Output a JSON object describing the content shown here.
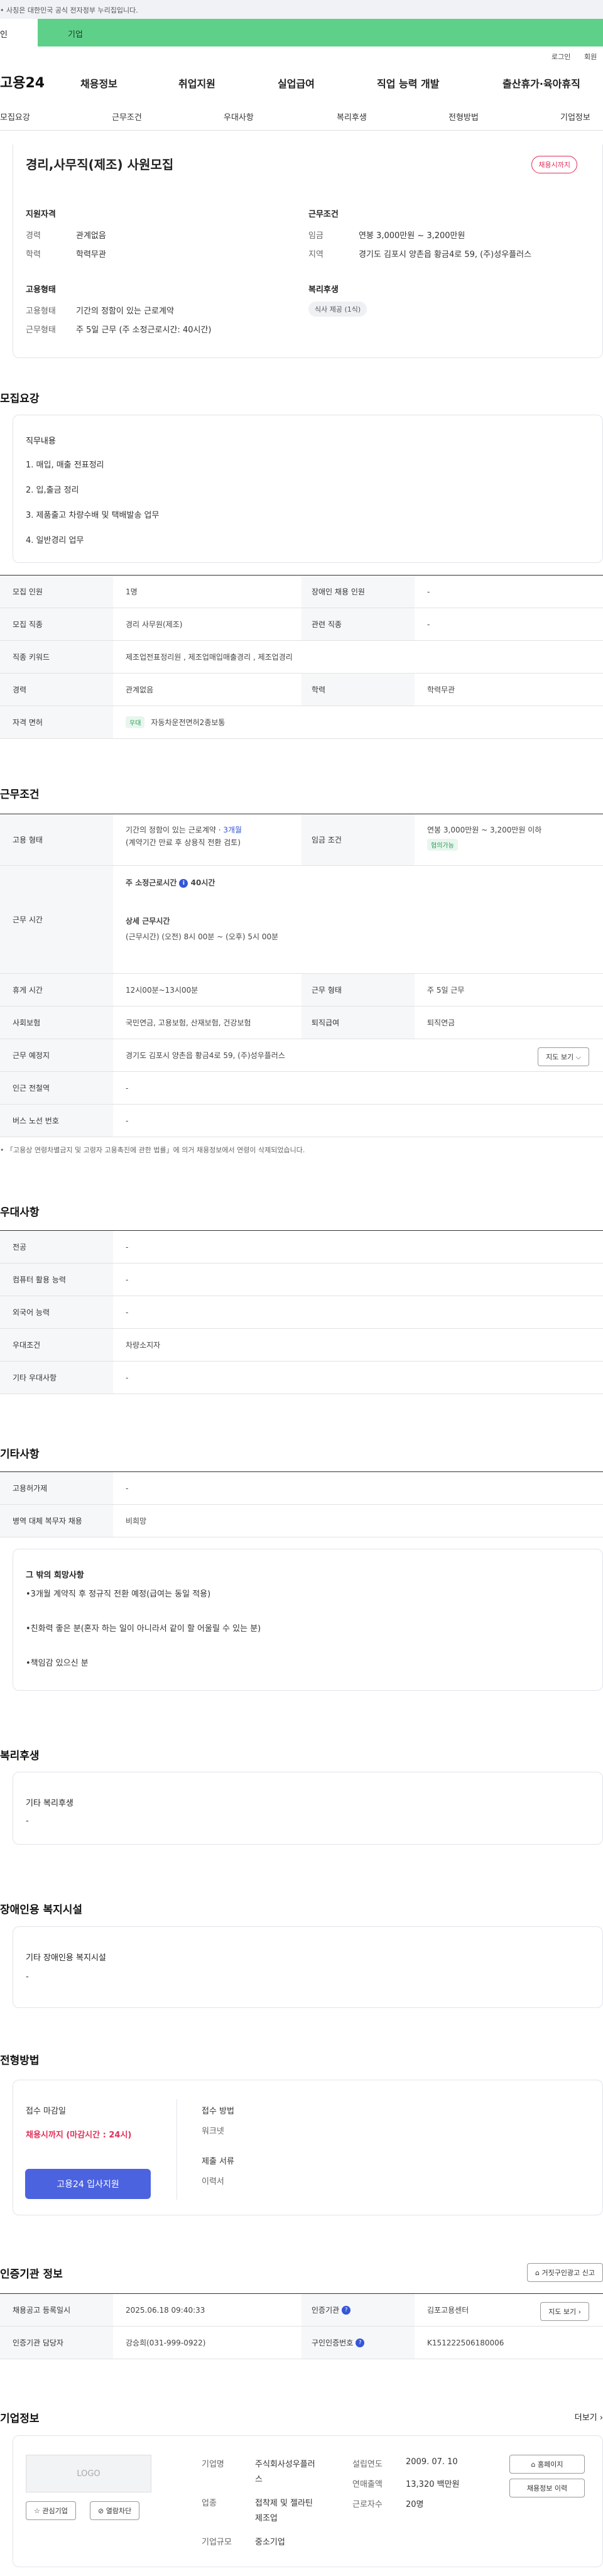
{
  "gov_notice": "• 사칭은 대한민국 공식 전자정부 누리집입니다.",
  "top_tabs": {
    "a": "인",
    "b": "기업"
  },
  "util": {
    "login": "로그인",
    "join": "회원"
  },
  "logo": "고용24",
  "gnb": [
    "채용정보",
    "취업지원",
    "실업급여",
    "직업 능력 개발",
    "출산휴가·육아휴직"
  ],
  "anchors": [
    "모집요강",
    "근무조건",
    "우대사항",
    "복리후생",
    "전형방법",
    "기업정보"
  ],
  "job": {
    "title": "경리,사무직(제조) 사원모집",
    "deadline_badge": "채용시까지",
    "qual_title": "지원자격",
    "career_k": "경력",
    "career_v": "관계없음",
    "edu_k": "학력",
    "edu_v": "학력무관",
    "cond_title": "근무조건",
    "wage_k": "임금",
    "wage_v": "연봉 3,000만원 ~ 3,200만원",
    "region_k": "지역",
    "region_v": "경기도 김포시 양촌읍 황금4로 59, (주)성우플러스",
    "emp_title": "고용형태",
    "type_k": "고용형태",
    "type_v": "기간의 정함이 있는 근로계약",
    "worktime_k": "근무형태",
    "worktime_v": "주 5일 근무 (주 소정근로시간: 40시간)",
    "welfare_title": "복리후생",
    "welfare_chip": "식사 제공 (1식)"
  },
  "recruit": {
    "title": "모집요강",
    "duty_title": "직무내용",
    "duties": [
      "1. 매입, 매출 전표정리",
      "2. 입,출금 정리",
      "3. 제품출고 차량수배 및 택배발송 업무",
      "4. 일반경리 업무"
    ],
    "rows": [
      {
        "k1": "모집 인원",
        "v1": "1명",
        "k2": "장애인 채용 인원",
        "v2": "-"
      },
      {
        "k1": "모집 직종",
        "v1": "경리 사무원(제조)",
        "k2": "관련 직종",
        "v2": "-"
      },
      {
        "k1": "직종 키워드",
        "v1": "제조업전표정리원 , 제조업매입매출경리 , 제조업경리",
        "k2": "",
        "v2": ""
      },
      {
        "k1": "경력",
        "v1": "관계없음",
        "k2": "학력",
        "v2": "학력무관"
      }
    ],
    "license_k": "자격 면허",
    "license_chip": "우대",
    "license_v": "자동차운전면허2종보통"
  },
  "work": {
    "title": "근무조건",
    "emp_k": "고용 형태",
    "emp_v1": "기간의 정함이 있는 근로계약 · ",
    "emp_v1b": "3개월",
    "emp_v2": "(계약기간 만료 후 상용직 전환 검토)",
    "wage_k": "임금 조건",
    "wage_v": "연봉 3,000만원 ~ 3,200만원 이하",
    "wage_chip": "협의가능",
    "time_k": "근무 시간",
    "time_l1": "주 소정근로시간",
    "time_l1b": "40시간",
    "time_l2": "상세 근무시간",
    "time_l3": "(근무시간) (오전) 8시 00분 ~ (오후) 5시 00분",
    "rest_k": "휴게 시간",
    "rest_v": "12시00분~13시00분",
    "form_k": "근무 형태",
    "form_v": "주 5일 근무",
    "ins_k": "사회보험",
    "ins_v": "국민연금, 고용보험, 산재보험, 건강보험",
    "sev_k": "퇴직급여",
    "sev_v": "퇴직연금",
    "place_k": "근무 예정지",
    "place_v": "경기도 김포시 양촌읍 황금4로 59, (주)성우플러스",
    "map_btn": "지도 보기",
    "subway_k": "인근 전철역",
    "subway_v": "-",
    "bus_k": "버스 노선 번호",
    "bus_v": "-",
    "note": "• 「고용상 연령차별금지 및 고령자 고용촉진에 관한 법률」에 의거 채용정보에서 연령이 삭제되었습니다."
  },
  "pref": {
    "title": "우대사항",
    "rows": [
      {
        "k": "전공",
        "v": "-"
      },
      {
        "k": "컴퓨터 활용 능력",
        "v": "-"
      },
      {
        "k": "외국어 능력",
        "v": "-"
      },
      {
        "k": "우대조건",
        "v": "차량소지자"
      },
      {
        "k": "기타 우대사항",
        "v": "-"
      }
    ]
  },
  "etc": {
    "title": "기타사항",
    "rows": [
      {
        "k": "고용허가제",
        "v": "-"
      },
      {
        "k": "병역 대체 복무자 채용",
        "v": "비희망"
      }
    ],
    "box_title": "그 밖의 희망사항",
    "lines": [
      "•3개월 계약직 후 정규직 전환 예정(급여는 동일 적용)",
      "•친화력 좋은 분(혼자 하는 일이 아니라서 같이 할 어울릴 수 있는 분)",
      "•책임감 있으신 분"
    ]
  },
  "benefit": {
    "title": "복리후생",
    "box_title": "기타 복리후생",
    "box_v": "-"
  },
  "disabled": {
    "title": "장애인용 복지시설",
    "box_title": "기타 장애인용 복지시설",
    "box_v": "-"
  },
  "screen": {
    "title": "전형방법",
    "deadline_k": "접수 마감일",
    "deadline_v": "채용시까지 (마감시간 : 24시)",
    "apply_btn": "고용24 입사지원",
    "method_k": "접수 방법",
    "method_v": "워크넷",
    "docs_k": "제출 서류",
    "docs_v": "이력서"
  },
  "cert": {
    "title": "인증기관 정보",
    "report_btn": "거짓구인광고 신고",
    "date_k": "채용공고 등록일시",
    "date_v": "2025.06.18 09:40:33",
    "org_k": "인증기관",
    "org_v": "김포고용센터",
    "map_btn": "지도 보기",
    "mgr_k": "인증기관 담당자",
    "mgr_v": "강승희(031-999-0922)",
    "num_k": "구인인증번호",
    "num_v": "K151222506180006"
  },
  "company": {
    "title": "기업정보",
    "more": "더보기",
    "logo": "LOGO",
    "fav_btn": "관심기업",
    "block_btn": "열람차단",
    "type_k": "기업명",
    "type_v1": "주식회사성우플러",
    "type_v2": "스",
    "ind_k": "업종",
    "ind_v1": "접착제 및 젤라틴",
    "ind_v2": "제조업",
    "size_k": "기업규모",
    "size_v": "중소기업",
    "est_k": "설립연도",
    "est_v": "2009. 07. 10",
    "sales_k": "연매출액",
    "sales_v": "13,320 백만원",
    "emp_k": "근로자수",
    "emp_v": "20명",
    "home_btn": "홈페이지",
    "jobs_btn": "채용정보 이력"
  }
}
